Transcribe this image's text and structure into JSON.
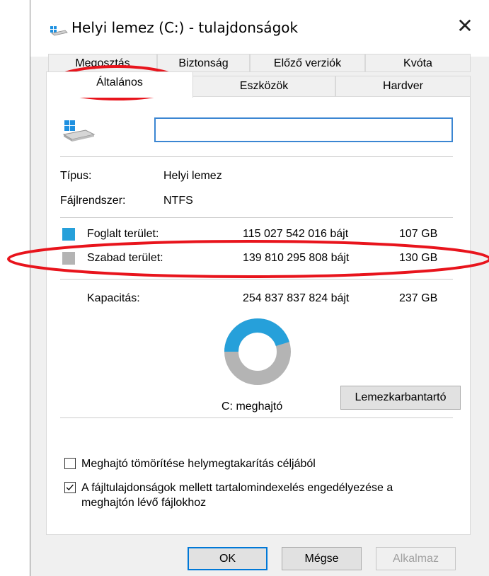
{
  "window": {
    "title": "Helyi lemez (C:) - tulajdonságok"
  },
  "tabs_row1": [
    {
      "label": "Megosztás"
    },
    {
      "label": "Biztonság"
    },
    {
      "label": "Előző verziók"
    },
    {
      "label": "Kvóta"
    }
  ],
  "tabs_row2": [
    {
      "label": "Általános",
      "active": true
    },
    {
      "label": "Eszközök"
    },
    {
      "label": "Hardver"
    }
  ],
  "general": {
    "name_value": "",
    "type_label": "Típus:",
    "type_value": "Helyi lemez",
    "fs_label": "Fájlrendszer:",
    "fs_value": "NTFS",
    "used": {
      "label": "Foglalt terület:",
      "bytes": "115 027 542 016 bájt",
      "gb": "107 GB",
      "color": "#26a0da"
    },
    "free": {
      "label": "Szabad terület:",
      "bytes": "139 810 295 808 bájt",
      "gb": "130 GB",
      "color": "#b4b4b4"
    },
    "capacity": {
      "label": "Kapacitás:",
      "bytes": "254 837 837 824 bájt",
      "gb": "237 GB"
    },
    "drive_label": "C: meghajtó",
    "cleanup_button": "Lemezkarbantartó",
    "used_fraction": 0.4514
  },
  "options": {
    "compress": {
      "label": "Meghajtó tömörítése helymegtakarítás céljából",
      "checked": false
    },
    "index_line1": "A fájltulajdonságok mellett tartalomindexelés engedélyezése a",
    "index_line2": "meghajtón lévő fájlokhoz",
    "index_checked": true
  },
  "buttons": {
    "ok": "OK",
    "cancel": "Mégse",
    "apply": "Alkalmaz"
  },
  "annotations_color": "#e8141c"
}
